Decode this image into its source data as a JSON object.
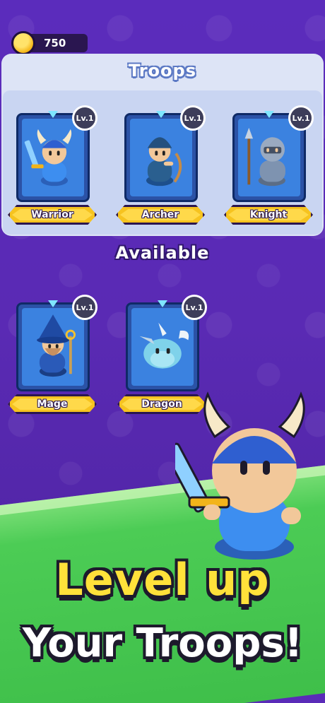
{
  "currency": {
    "icon": "coin-icon",
    "amount": "750"
  },
  "troops_panel": {
    "title": "Troops",
    "cards": [
      {
        "name": "Warrior",
        "level": "Lv.1",
        "icon": "warrior-icon"
      },
      {
        "name": "Archer",
        "level": "Lv.1",
        "icon": "archer-icon"
      },
      {
        "name": "Knight",
        "level": "Lv.1",
        "icon": "knight-icon"
      }
    ]
  },
  "available_panel": {
    "title": "Available",
    "cards": [
      {
        "name": "Mage",
        "level": "Lv.1",
        "icon": "mage-icon"
      },
      {
        "name": "Dragon",
        "level": "Lv.1",
        "icon": "dragon-icon"
      }
    ]
  },
  "promo": {
    "line1": "Level up",
    "line2": "Your Troops!"
  },
  "colors": {
    "background": "#5a2bb8",
    "panel": "#dde4f6",
    "card": "#3b82e0",
    "label": "#f6c31f",
    "headline": "#ffe13a",
    "ground": "#4ccc55"
  }
}
